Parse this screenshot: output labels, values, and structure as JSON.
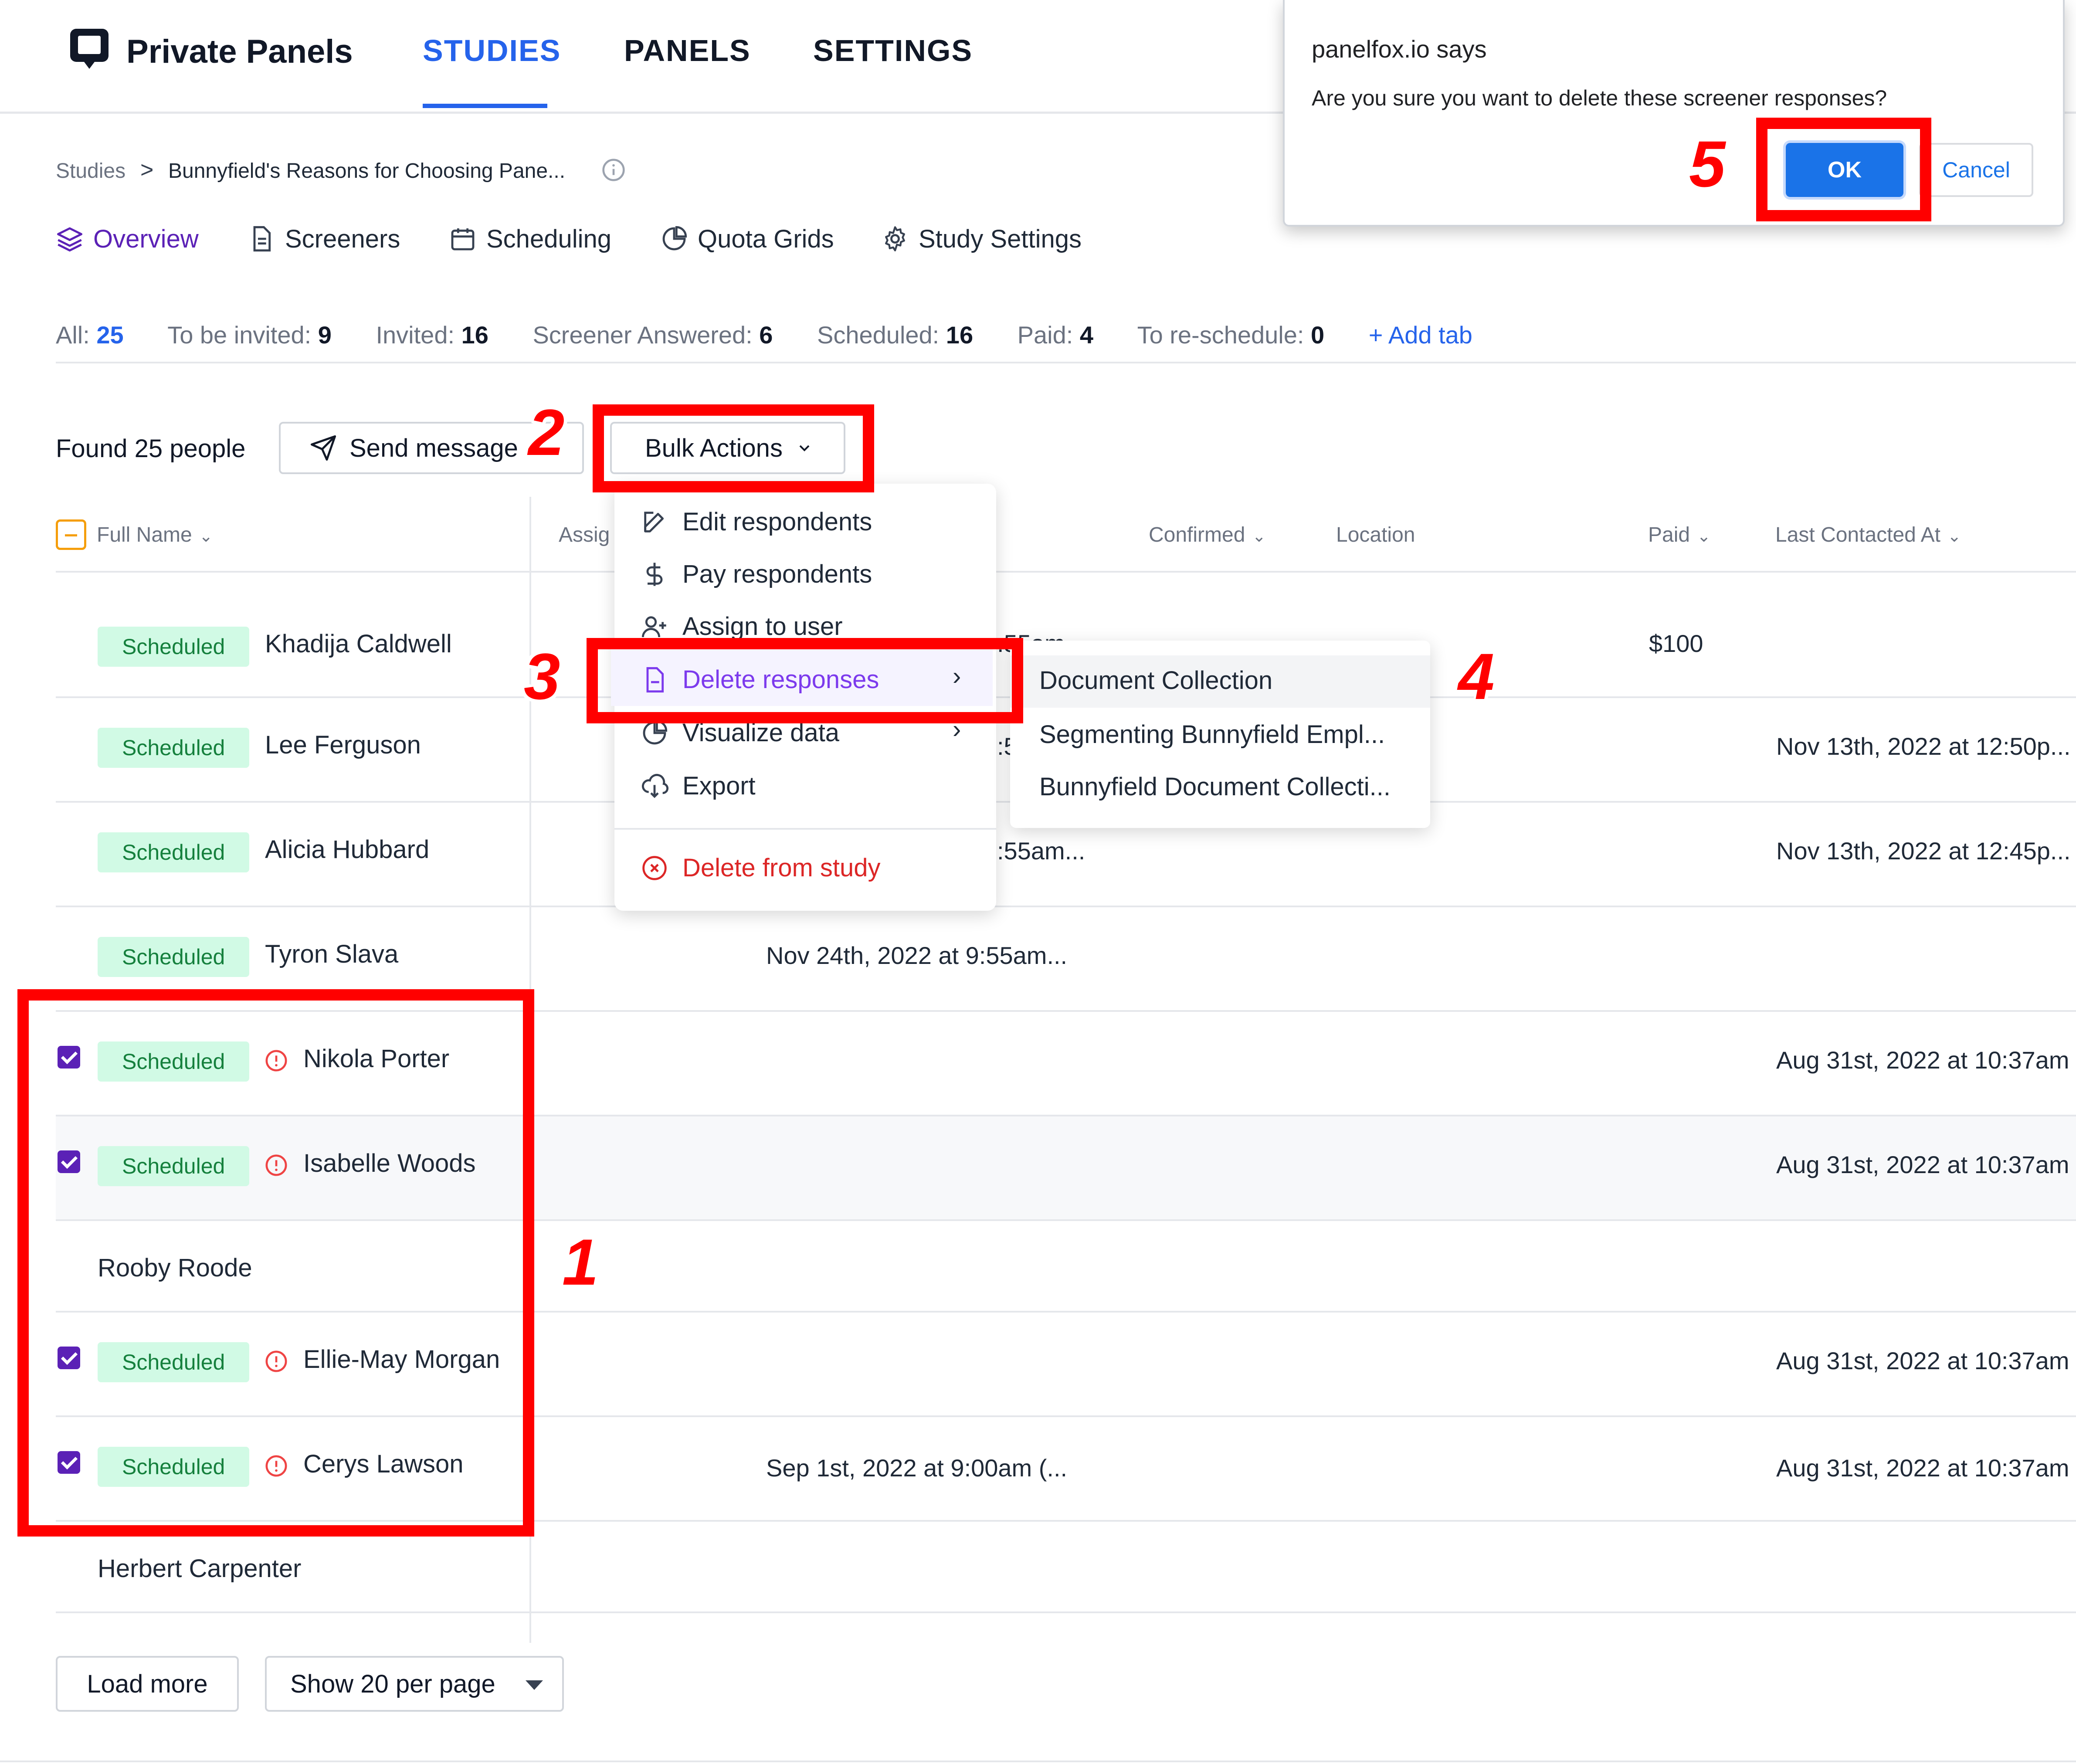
{
  "brand": {
    "name": "Private Panels"
  },
  "nav": {
    "studies": "STUDIES",
    "panels": "PANELS",
    "settings": "SETTINGS"
  },
  "breadcrumb": {
    "root": "Studies",
    "separator": ">",
    "current": "Bunnyfield's Reasons for Choosing Pane..."
  },
  "subtabs": {
    "overview": "Overview",
    "screeners": "Screeners",
    "scheduling": "Scheduling",
    "quota": "Quota Grids",
    "settings": "Study Settings"
  },
  "counts": {
    "all_label": "All:",
    "all": "25",
    "invite_label": "To be invited:",
    "invite": "9",
    "invited_label": "Invited:",
    "invited": "16",
    "answered_label": "Screener Answered:",
    "answered": "6",
    "scheduled_label": "Scheduled:",
    "scheduled": "16",
    "paid_label": "Paid:",
    "paid": "4",
    "resched_label": "To re-schedule:",
    "resched": "0",
    "add_tab": "+ Add tab"
  },
  "toolbar": {
    "found": "Found 25 people",
    "send_message": "Send message",
    "bulk_actions": "Bulk Actions"
  },
  "table_headers": {
    "full_name": "Full Name",
    "assign": "Assig",
    "confirmed": "Confirmed",
    "location": "Location",
    "paid": "Paid",
    "last_contacted": "Last Contacted At"
  },
  "rows": [
    {
      "status": "Scheduled",
      "name": "Khadija Caldwell",
      "mid": ":55am...",
      "paid": "$100",
      "last": ""
    },
    {
      "status": "Scheduled",
      "name": "Lee Ferguson",
      "mid": ":5",
      "paid": "",
      "last": "Nov 13th, 2022 at 12:50p..."
    },
    {
      "status": "Scheduled",
      "name": "Alicia Hubbard",
      "mid": ":55am...",
      "paid": "",
      "last": "Nov 13th, 2022 at 12:45p..."
    },
    {
      "status": "Scheduled",
      "name": "Tyron Slava",
      "mid": "Nov 24th, 2022 at 9:55am...",
      "paid": "",
      "last": ""
    },
    {
      "status": "Scheduled",
      "name": "Nikola Porter",
      "mid": "",
      "paid": "",
      "last": "Aug 31st, 2022 at 10:37am"
    },
    {
      "status": "Scheduled",
      "name": "Isabelle Woods",
      "mid": "",
      "paid": "",
      "last": "Aug 31st, 2022 at 10:37am"
    },
    {
      "status": "",
      "name": "Rooby Roode",
      "mid": "",
      "paid": "",
      "last": ""
    },
    {
      "status": "Scheduled",
      "name": "Ellie-May Morgan",
      "mid": "",
      "paid": "",
      "last": "Aug 31st, 2022 at 10:37am"
    },
    {
      "status": "Scheduled",
      "name": "Cerys Lawson",
      "mid": "Sep 1st, 2022 at 9:00am (...",
      "paid": "",
      "last": "Aug 31st, 2022 at 10:37am"
    },
    {
      "status": "",
      "name": "Herbert Carpenter",
      "mid": "",
      "paid": "",
      "last": ""
    }
  ],
  "bulk_menu": {
    "edit": "Edit respondents",
    "pay": "Pay respondents",
    "assign": "Assign to user",
    "delete_responses": "Delete responses",
    "visualize": "Visualize data",
    "export": "Export",
    "delete_study": "Delete from study"
  },
  "submenu": [
    "Document Collection",
    "Segmenting Bunnyfield Empl...",
    "Bunnyfield Document Collecti..."
  ],
  "dialog": {
    "title": "panelfox.io says",
    "message": "Are you sure you want to delete these screener responses?",
    "ok": "OK",
    "cancel": "Cancel"
  },
  "annotations": {
    "step1": "1",
    "step2": "2",
    "step3": "3",
    "step4": "4",
    "step5": "5"
  },
  "footer": {
    "load_more": "Load more",
    "per_page": "Show 20 per page"
  },
  "colors": {
    "accent": "#2563eb",
    "purple": "#5b21b6",
    "danger": "#dc2626",
    "badge_bg": "#d1fae5",
    "badge_text": "#15803d",
    "annotation": "#ff0000"
  }
}
